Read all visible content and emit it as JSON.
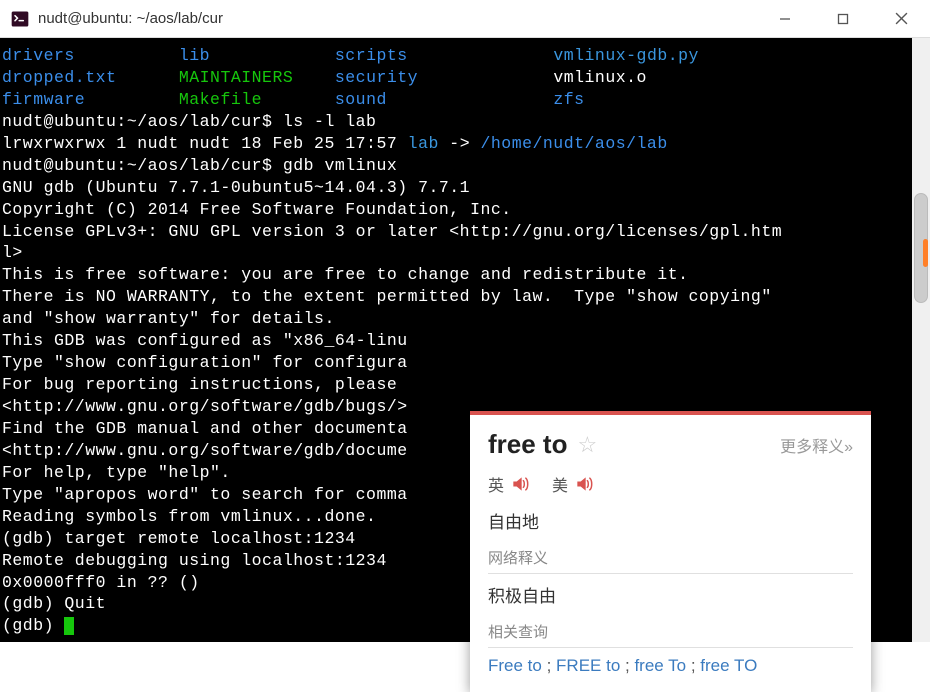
{
  "window": {
    "title": "nudt@ubuntu: ~/aos/lab/cur"
  },
  "terminal": {
    "row1": {
      "drivers": "drivers",
      "lib": "lib",
      "scripts": "scripts",
      "vmgdb": "vmlinux-gdb.py"
    },
    "row2": {
      "dropped": "dropped.txt",
      "maintainers": "MAINTAINERS",
      "security": "security",
      "vmo": "vmlinux.o"
    },
    "row3": {
      "firmware": "firmware",
      "makefile": "Makefile",
      "sound": "sound",
      "zfs": "zfs"
    },
    "prompt1": "nudt@ubuntu:~/aos/lab/cur$ ls -l lab",
    "ls_perm": "lrwxrwxrwx 1 nudt nudt 18 Feb 25 17:57 ",
    "ls_name": "lab",
    "ls_arrow": " -> ",
    "ls_target": "/home/nudt/aos/lab",
    "prompt2": "nudt@ubuntu:~/aos/lab/cur$ gdb vmlinux",
    "gdb1": "GNU gdb (Ubuntu 7.7.1-0ubuntu5~14.04.3) 7.7.1",
    "gdb2": "Copyright (C) 2014 Free Software Foundation, Inc.",
    "gdb3": "License GPLv3+: GNU GPL version 3 or later <http://gnu.org/licenses/gpl.htm",
    "gdb3b": "l>",
    "gdb4": "This is free software: you are free to change and redistribute it.",
    "gdb5": "There is NO WARRANTY, to the extent permitted by law.  Type \"show copying\"",
    "gdb6": "and \"show warranty\" for details.",
    "gdb7": "This GDB was configured as \"x86_64-linu",
    "gdb8": "Type \"show configuration\" for configura",
    "gdb9": "For bug reporting instructions, please ",
    "gdb10": "<http://www.gnu.org/software/gdb/bugs/>",
    "gdb11": "Find the GDB manual and other documenta",
    "gdb12": "<http://www.gnu.org/software/gdb/docume",
    "gdb13": "For help, type \"help\".",
    "gdb14": "Type \"apropos word\" to search for comma",
    "gdb15": "Reading symbols from vmlinux...done.",
    "gdb16": "(gdb) target remote localhost:1234",
    "gdb17": "Remote debugging using localhost:1234",
    "gdb18": "0x0000fff0 in ?? ()",
    "gdb19": "(gdb) Quit",
    "gdb20": "(gdb) "
  },
  "dict": {
    "word": "free to",
    "more": "更多释义»",
    "pron_uk": "英",
    "pron_us": "美",
    "def": "自由地",
    "net_label": "网络释义",
    "net_def": "积极自由",
    "related_label": "相关查询",
    "links": {
      "l1": "Free to",
      "l2": "FREE to",
      "l3": "free To",
      "l4": "free TO"
    },
    "sep": " ; "
  }
}
